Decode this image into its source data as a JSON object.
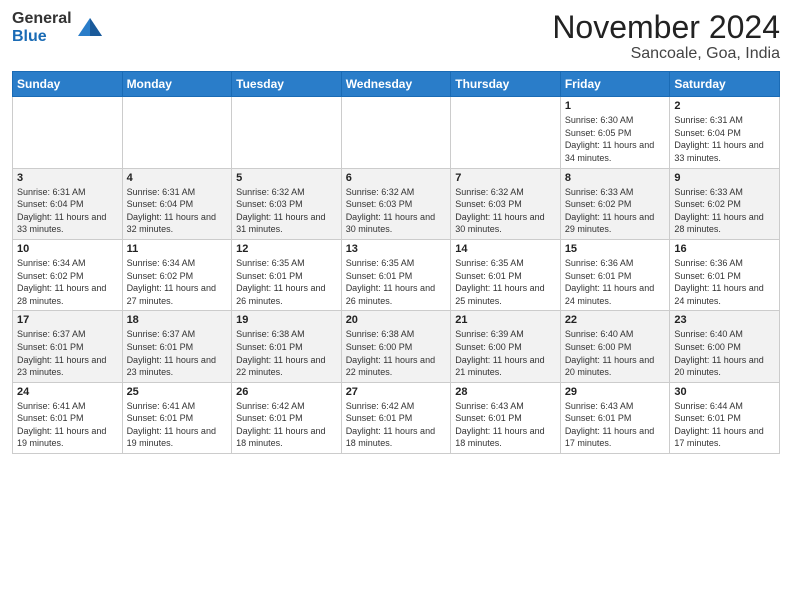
{
  "header": {
    "logo_general": "General",
    "logo_blue": "Blue",
    "month_title": "November 2024",
    "location": "Sancoale, Goa, India"
  },
  "days_of_week": [
    "Sunday",
    "Monday",
    "Tuesday",
    "Wednesday",
    "Thursday",
    "Friday",
    "Saturday"
  ],
  "weeks": [
    [
      {
        "day": "",
        "info": ""
      },
      {
        "day": "",
        "info": ""
      },
      {
        "day": "",
        "info": ""
      },
      {
        "day": "",
        "info": ""
      },
      {
        "day": "",
        "info": ""
      },
      {
        "day": "1",
        "info": "Sunrise: 6:30 AM\nSunset: 6:05 PM\nDaylight: 11 hours and 34 minutes."
      },
      {
        "day": "2",
        "info": "Sunrise: 6:31 AM\nSunset: 6:04 PM\nDaylight: 11 hours and 33 minutes."
      }
    ],
    [
      {
        "day": "3",
        "info": "Sunrise: 6:31 AM\nSunset: 6:04 PM\nDaylight: 11 hours and 33 minutes."
      },
      {
        "day": "4",
        "info": "Sunrise: 6:31 AM\nSunset: 6:04 PM\nDaylight: 11 hours and 32 minutes."
      },
      {
        "day": "5",
        "info": "Sunrise: 6:32 AM\nSunset: 6:03 PM\nDaylight: 11 hours and 31 minutes."
      },
      {
        "day": "6",
        "info": "Sunrise: 6:32 AM\nSunset: 6:03 PM\nDaylight: 11 hours and 30 minutes."
      },
      {
        "day": "7",
        "info": "Sunrise: 6:32 AM\nSunset: 6:03 PM\nDaylight: 11 hours and 30 minutes."
      },
      {
        "day": "8",
        "info": "Sunrise: 6:33 AM\nSunset: 6:02 PM\nDaylight: 11 hours and 29 minutes."
      },
      {
        "day": "9",
        "info": "Sunrise: 6:33 AM\nSunset: 6:02 PM\nDaylight: 11 hours and 28 minutes."
      }
    ],
    [
      {
        "day": "10",
        "info": "Sunrise: 6:34 AM\nSunset: 6:02 PM\nDaylight: 11 hours and 28 minutes."
      },
      {
        "day": "11",
        "info": "Sunrise: 6:34 AM\nSunset: 6:02 PM\nDaylight: 11 hours and 27 minutes."
      },
      {
        "day": "12",
        "info": "Sunrise: 6:35 AM\nSunset: 6:01 PM\nDaylight: 11 hours and 26 minutes."
      },
      {
        "day": "13",
        "info": "Sunrise: 6:35 AM\nSunset: 6:01 PM\nDaylight: 11 hours and 26 minutes."
      },
      {
        "day": "14",
        "info": "Sunrise: 6:35 AM\nSunset: 6:01 PM\nDaylight: 11 hours and 25 minutes."
      },
      {
        "day": "15",
        "info": "Sunrise: 6:36 AM\nSunset: 6:01 PM\nDaylight: 11 hours and 24 minutes."
      },
      {
        "day": "16",
        "info": "Sunrise: 6:36 AM\nSunset: 6:01 PM\nDaylight: 11 hours and 24 minutes."
      }
    ],
    [
      {
        "day": "17",
        "info": "Sunrise: 6:37 AM\nSunset: 6:01 PM\nDaylight: 11 hours and 23 minutes."
      },
      {
        "day": "18",
        "info": "Sunrise: 6:37 AM\nSunset: 6:01 PM\nDaylight: 11 hours and 23 minutes."
      },
      {
        "day": "19",
        "info": "Sunrise: 6:38 AM\nSunset: 6:01 PM\nDaylight: 11 hours and 22 minutes."
      },
      {
        "day": "20",
        "info": "Sunrise: 6:38 AM\nSunset: 6:00 PM\nDaylight: 11 hours and 22 minutes."
      },
      {
        "day": "21",
        "info": "Sunrise: 6:39 AM\nSunset: 6:00 PM\nDaylight: 11 hours and 21 minutes."
      },
      {
        "day": "22",
        "info": "Sunrise: 6:40 AM\nSunset: 6:00 PM\nDaylight: 11 hours and 20 minutes."
      },
      {
        "day": "23",
        "info": "Sunrise: 6:40 AM\nSunset: 6:00 PM\nDaylight: 11 hours and 20 minutes."
      }
    ],
    [
      {
        "day": "24",
        "info": "Sunrise: 6:41 AM\nSunset: 6:01 PM\nDaylight: 11 hours and 19 minutes."
      },
      {
        "day": "25",
        "info": "Sunrise: 6:41 AM\nSunset: 6:01 PM\nDaylight: 11 hours and 19 minutes."
      },
      {
        "day": "26",
        "info": "Sunrise: 6:42 AM\nSunset: 6:01 PM\nDaylight: 11 hours and 18 minutes."
      },
      {
        "day": "27",
        "info": "Sunrise: 6:42 AM\nSunset: 6:01 PM\nDaylight: 11 hours and 18 minutes."
      },
      {
        "day": "28",
        "info": "Sunrise: 6:43 AM\nSunset: 6:01 PM\nDaylight: 11 hours and 18 minutes."
      },
      {
        "day": "29",
        "info": "Sunrise: 6:43 AM\nSunset: 6:01 PM\nDaylight: 11 hours and 17 minutes."
      },
      {
        "day": "30",
        "info": "Sunrise: 6:44 AM\nSunset: 6:01 PM\nDaylight: 11 hours and 17 minutes."
      }
    ]
  ]
}
